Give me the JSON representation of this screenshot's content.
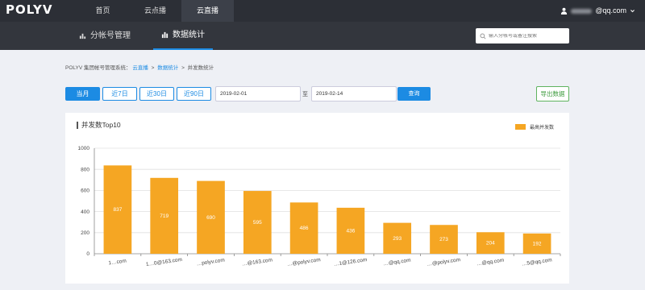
{
  "header": {
    "logo": "POLYV",
    "nav": [
      {
        "label": "首页",
        "active": false
      },
      {
        "label": "云点播",
        "active": false
      },
      {
        "label": "云直播",
        "active": true
      }
    ],
    "user_email_suffix": "@qq.com",
    "user_icon": "user-icon",
    "dropdown_icon": "chevron-down-icon"
  },
  "subnav": {
    "items": [
      {
        "label": "分帐号管理",
        "icon": "bar-chart-icon",
        "active": false
      },
      {
        "label": "数据统计",
        "icon": "stats-icon",
        "active": true
      }
    ],
    "search_placeholder": "输入分帐号或备注搜索"
  },
  "breadcrumb": {
    "root": "POLYV 集团帐号管理系统",
    "sep1": "：",
    "crumb1": "云直播",
    "crumb2": "数据统计",
    "crumb3": "并发数统计",
    "separator": ">"
  },
  "filters": {
    "ranges": [
      {
        "label": "当月",
        "active": true
      },
      {
        "label": "近7日",
        "active": false
      },
      {
        "label": "近30日",
        "active": false
      },
      {
        "label": "近90日",
        "active": false
      }
    ],
    "start_date": "2019-02-01",
    "to_label": "至",
    "end_date": "2019-02-14",
    "query_label": "查询",
    "export_label": "导出数据"
  },
  "panel": {
    "title": "并发数Top10"
  },
  "colors": {
    "bar": "#f5a623",
    "primary": "#1c8be3"
  },
  "chart_data": {
    "type": "bar",
    "title": "并发数Top10",
    "legend": "最高并发数",
    "legend_position": "top-right",
    "ylim": [
      0,
      1000
    ],
    "yticks": [
      0,
      200,
      400,
      600,
      800,
      1000
    ],
    "grid": true,
    "categories": [
      "1…com",
      "1…0@163.com",
      "…polyv.com",
      "…@163.com",
      "…@polyv.com",
      "…1@126.com",
      "…@qq.com",
      "…@polyv.com",
      "…@qq.com",
      "…5@qq.com"
    ],
    "values": [
      837,
      719,
      690,
      595,
      486,
      436,
      293,
      273,
      204,
      192
    ]
  }
}
